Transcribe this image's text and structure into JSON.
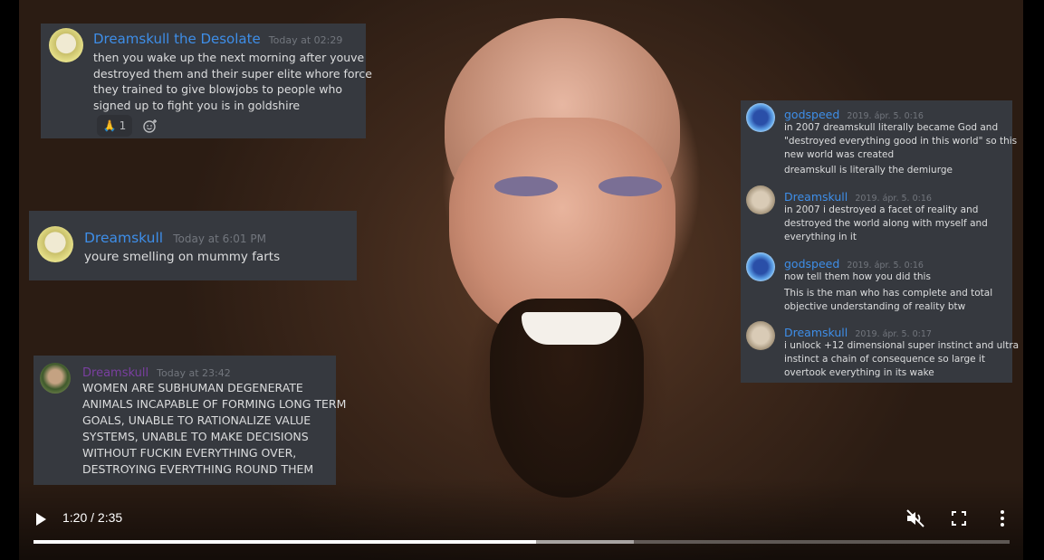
{
  "video": {
    "current_time": "1:20",
    "duration": "2:35",
    "time_display": "1:20 / 2:35",
    "progress_fraction": 0.515,
    "buffered_fraction": 0.615,
    "muted": true
  },
  "overlay_messages": {
    "card1": {
      "username": "Dreamskull the Desolate",
      "username_color": "#3e8ee8",
      "timestamp": "Today at 02:29",
      "lines": [
        "then you wake up the next morning after youve",
        "destroyed them and their super elite whore force",
        "they trained to give blowjobs to people who",
        "signed up to fight you is in goldshire"
      ],
      "reaction_emoji": "🙏",
      "reaction_count": "1"
    },
    "card2": {
      "username": "Dreamskull",
      "username_color": "#3e8ee8",
      "timestamp": "Today at 6:01 PM",
      "text": "youre smelling on mummy farts"
    },
    "card3": {
      "username": "Dreamskull",
      "username_color": "#7a3fa0",
      "timestamp": "Today at 23:42",
      "lines": [
        "WOMEN ARE SUBHUMAN DEGENERATE",
        "ANIMALS INCAPABLE OF FORMING LONG TERM",
        "GOALS, UNABLE TO RATIONALIZE VALUE",
        "SYSTEMS, UNABLE TO MAKE DECISIONS",
        "WITHOUT FUCKIN EVERYTHING OVER,",
        "DESTROYING EVERYTHING ROUND THEM"
      ]
    },
    "card4": {
      "messages": [
        {
          "username": "godspeed",
          "timestamp": "2019. ápr. 5. 0:16",
          "lines": [
            "in 2007 dreamskull literally became God and",
            "\"destroyed everything good in this world\" so this",
            "new world was created"
          ],
          "extra": "dreamskull is literally the demiurge"
        },
        {
          "username": "Dreamskull",
          "timestamp": "2019. ápr. 5. 0:16",
          "lines": [
            "in 2007 i destroyed a facet of reality and",
            "destroyed the world along with myself and",
            "everything in it"
          ]
        },
        {
          "username": "godspeed",
          "timestamp": "2019. ápr. 5. 0:16",
          "lines": [
            "now tell them how you did this"
          ],
          "extra_lines": [
            "This is the man who has complete and total",
            "objective understanding of reality btw"
          ]
        },
        {
          "username": "Dreamskull",
          "timestamp": "2019. ápr. 5. 0:17",
          "lines": [
            "i unlock +12 dimensional super instinct and ultra",
            "instinct a chain of consequence so large it",
            "overtook everything in its wake"
          ]
        }
      ]
    }
  },
  "icons": {
    "play": "play-icon",
    "mute": "muted-speaker-icon",
    "fullscreen": "fullscreen-icon",
    "more": "more-vert-icon"
  }
}
